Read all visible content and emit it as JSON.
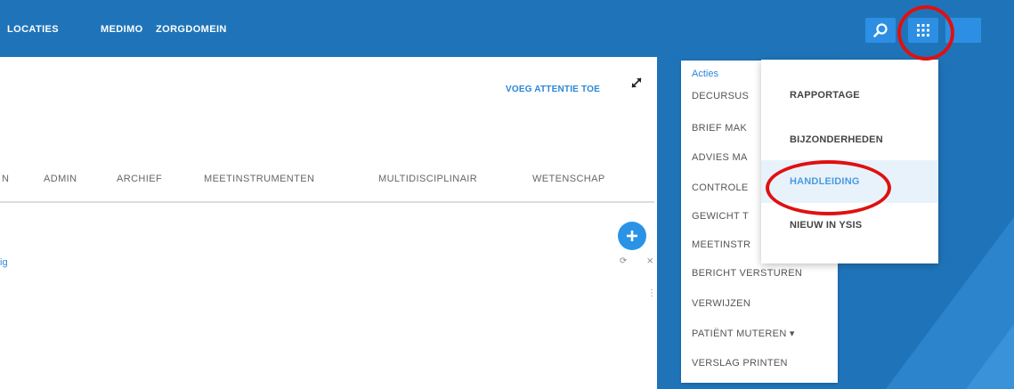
{
  "topbar": {
    "nav": [
      "LOCATIES",
      "MEDIMO",
      "ZORGDOMEIN"
    ],
    "search_icon": "search-icon",
    "apps_icon": "grid-icon"
  },
  "main": {
    "add_attention_label": "VOEG ATTENTIE TOE",
    "tabs": [
      "N",
      "ADMIN",
      "ARCHIEF",
      "MEETINSTRUMENTEN",
      "MULTIDISCIPLINAIR",
      "WETENSCHAP"
    ],
    "link_fragment": "ig",
    "colors": {
      "primary": "#1f74b9",
      "accent": "#2b86d8",
      "highlight": "#e01010"
    }
  },
  "actions": {
    "header": "Acties",
    "items": [
      "DECURSUS",
      "BRIEF MAK",
      "ADVIES MA",
      "CONTROLE",
      "GEWICHT T",
      "MEETINSTR",
      "BERICHT VERSTUREN",
      "VERWIJZEN",
      "PATIËNT MUTEREN ▾",
      "VERSLAG PRINTEN"
    ]
  },
  "dropdown": {
    "items": [
      "RAPPORTAGE",
      "BIJZONDERHEDEN",
      "HANDLEIDING",
      "NIEUW IN YSIS"
    ],
    "highlighted": "HANDLEIDING"
  }
}
